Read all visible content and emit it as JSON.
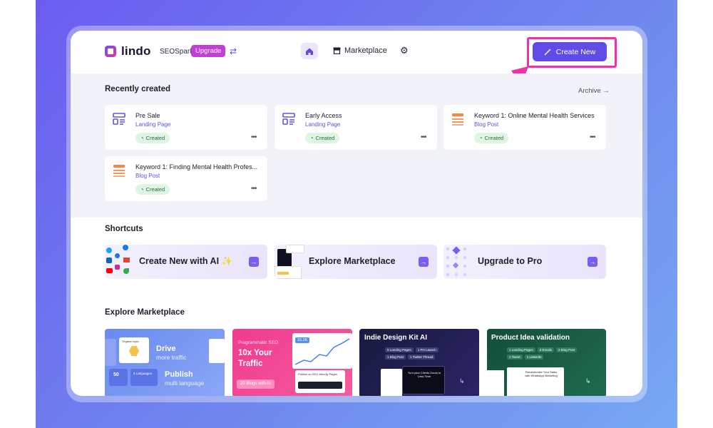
{
  "header": {
    "app_name": "lindo",
    "workspace": "SEOSpark",
    "upgrade_label": "Upgrade",
    "marketplace_label": "Marketplace",
    "create_new_label": "Create New"
  },
  "recent": {
    "title": "Recently created",
    "archive_label": "Archive →",
    "items": [
      {
        "title": "Pre Sale",
        "type": "Landing Page",
        "status": "Created"
      },
      {
        "title": "Early Access",
        "type": "Landing Page",
        "status": "Created"
      },
      {
        "title": "Keyword 1: Online Mental Health Services",
        "type": "Blog Post",
        "status": "Created"
      },
      {
        "title": "Keyword 1: Finding Mental Health Profes...",
        "type": "Blog Post",
        "status": "Created"
      }
    ]
  },
  "shortcuts": {
    "title": "Shortcuts",
    "items": [
      {
        "label": "Create New with AI ✨"
      },
      {
        "label": "Explore Marketplace"
      },
      {
        "label": "Upgrade to Pro"
      }
    ]
  },
  "explore": {
    "title": "Explore Marketplace",
    "cards": [
      {
        "heading": "Drive",
        "sub": "more traffic",
        "heading2": "Publish",
        "sub2": "multi language",
        "stat1": "50",
        "stat2": "5 Languages",
        "badge": "Organic topic"
      },
      {
        "kicker": "Programmatic SEO",
        "heading": "10x Your Traffic",
        "pill": "20 Blogs with AI",
        "stat": "15.2K",
        "caption": "Publish on SEO-friendly Pages"
      },
      {
        "heading": "Indie Design Kit AI",
        "chips": [
          "5 Landing Pages",
          "1 PH Launch",
          "1 Blog Post",
          "1 Twitter Thread"
        ],
        "promo": "Turn your Clients Doors in Less Time"
      },
      {
        "heading": "Product Idea validation",
        "chips": [
          "1 Landing Pages",
          "2 Emails",
          "2 Blog Post",
          "1 Tweet",
          "1 LinkedIn"
        ],
        "promo": "Revolutionize Your Sales with WhatsApp Marketing"
      }
    ]
  },
  "colors": {
    "accent": "#5f4ce8",
    "highlight": "#f22fa6",
    "status_green": "#dff5e3"
  }
}
